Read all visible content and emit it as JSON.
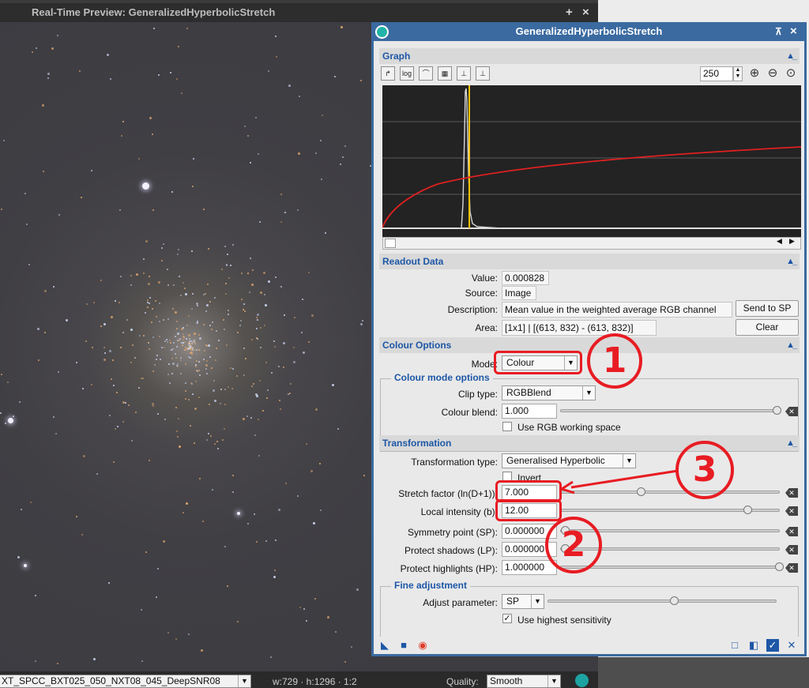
{
  "preview": {
    "title": "Real-Time Preview: GeneralizedHyperbolicStretch",
    "add_icon": "+",
    "close_icon": "×",
    "view_id": "XT_SPCC_BXT025_050_NXT08_045_DeepSNR08",
    "dims": "w:729 · h:1296 · 1:2",
    "quality_label": "Quality:",
    "quality_value": "Smooth"
  },
  "dialog": {
    "title": "GeneralizedHyperbolicStretch",
    "graph": {
      "header": "Graph",
      "zoom_value": "250",
      "toolbar_icons": [
        "link-icon",
        "log-icon",
        "curve-icon",
        "grid-icon",
        "histogram-icon",
        "combined-histogram-icon"
      ]
    },
    "readout": {
      "header": "Readout Data",
      "value_label": "Value:",
      "value": "0.000828",
      "source_label": "Source:",
      "source": "Image",
      "description_label": "Description:",
      "description": "Mean value in the weighted average RGB channel",
      "send_button": "Send to SP",
      "area_label": "Area:",
      "area": "[1x1] | [(613, 832) - (613, 832)]",
      "clear_button": "Clear"
    },
    "colour_options": {
      "header": "Colour Options",
      "mode_label": "Mode:",
      "mode_value": "Colour",
      "group_title": "Colour mode options",
      "clip_label": "Clip type:",
      "clip_value": "RGBBlend",
      "blend_label": "Colour blend:",
      "blend_value": "1.000",
      "blend_level": 1.0,
      "rgb_ws_label": "Use RGB working space"
    },
    "transformation": {
      "header": "Transformation",
      "type_label": "Transformation type:",
      "type_value": "Generalised Hyperbolic",
      "invert_label": "Invert",
      "stretch_label": "Stretch factor (ln(D+1)):",
      "stretch_value": "7.000",
      "local_label": "Local intensity (b):",
      "local_value": "12.00",
      "sp_label": "Symmetry point (SP):",
      "sp_value": "0.000000",
      "lp_label": "Protect shadows (LP):",
      "lp_value": "0.000000",
      "hp_label": "Protect highlights (HP):",
      "hp_value": "1.000000"
    },
    "fine": {
      "group_title": "Fine adjustment",
      "adjust_label": "Adjust parameter:",
      "adjust_value": "SP",
      "sensitivity_label": "Use highest sensitivity"
    }
  },
  "annotations": [
    "1",
    "2",
    "3"
  ],
  "colors": {
    "dialog_frame": "#3a6aa0",
    "section_text": "#1d57a6",
    "annotation": "#e81c23",
    "curve": "#e02020",
    "marker": "#f2c200"
  }
}
